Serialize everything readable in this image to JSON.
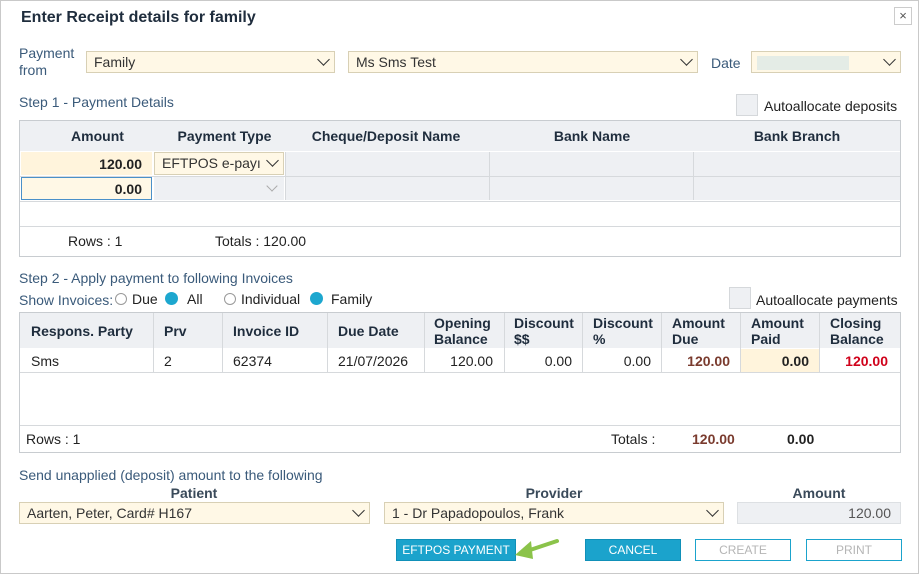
{
  "dialog": {
    "title": "Enter Receipt details for family",
    "close_glyph": "×"
  },
  "header": {
    "payment_from_label": "Payment\nfrom",
    "payment_from_value": "Family",
    "person_value": "Ms Sms  Test",
    "date_label": "Date",
    "date_value": ""
  },
  "step1": {
    "title": "Step 1 - Payment Details",
    "autoallocate_label": "Autoallocate deposits",
    "columns": [
      "Amount",
      "Payment Type",
      "Cheque/Deposit Name",
      "Bank Name",
      "Bank Branch"
    ],
    "rows": [
      {
        "amount": "120.00",
        "payment_type": "EFTPOS e-payı"
      },
      {
        "amount": "0.00",
        "payment_type": ""
      }
    ],
    "rows_label": "Rows : 1",
    "totals_label": "Totals : 120.00"
  },
  "step2": {
    "title": "Step 2 - Apply payment to following Invoices",
    "show_invoices_label": "Show Invoices:",
    "radio_due": "Due",
    "radio_all": "All",
    "radio_individual": "Individual",
    "radio_family": "Family",
    "autoallocate_label": "Autoallocate payments",
    "columns": {
      "party": "Respons. Party",
      "prv": "Prv",
      "invoice_id": "Invoice ID",
      "due_date": "Due Date",
      "opening_1": "Opening",
      "opening_2": "Balance",
      "disc_1": "Discount",
      "disc_2": "$$",
      "discp_1": "Discount",
      "discp_2": "%",
      "amt_due_1": "Amount",
      "amt_due_2": "Due",
      "amt_paid_1": "Amount",
      "amt_paid_2": "Paid",
      "closing_1": "Closing",
      "closing_2": "Balance"
    },
    "row": {
      "party": "Sms",
      "prv": "2",
      "invoice_id": "62374",
      "due_date": "21/07/2026",
      "opening": "120.00",
      "discount": "0.00",
      "discount_pct": "0.00",
      "amount_due": "120.00",
      "amount_paid": "0.00",
      "closing": "120.00"
    },
    "rows_label": "Rows : 1",
    "totals_label": "Totals :",
    "total_due": "120.00",
    "total_paid": "0.00"
  },
  "unapplied": {
    "title": "Send unapplied (deposit) amount to the following",
    "patient_label": "Patient",
    "patient_value": "Aarten, Peter, Card# H167",
    "provider_label": "Provider",
    "provider_value": "1 - Dr Papadopoulos, Frank",
    "amount_label": "Amount",
    "amount_value": "120.00"
  },
  "buttons": {
    "eftpos": "EFTPOS PAYMENT",
    "cancel": "CANCEL",
    "create": "CREATE",
    "print": "PRINT"
  },
  "colors": {
    "accent": "#1ba3cc",
    "amount_due": "#7a3b2e",
    "closing_balance": "#d0021b",
    "field_bg": "#fff8e6",
    "arrow": "#8bc34a"
  }
}
